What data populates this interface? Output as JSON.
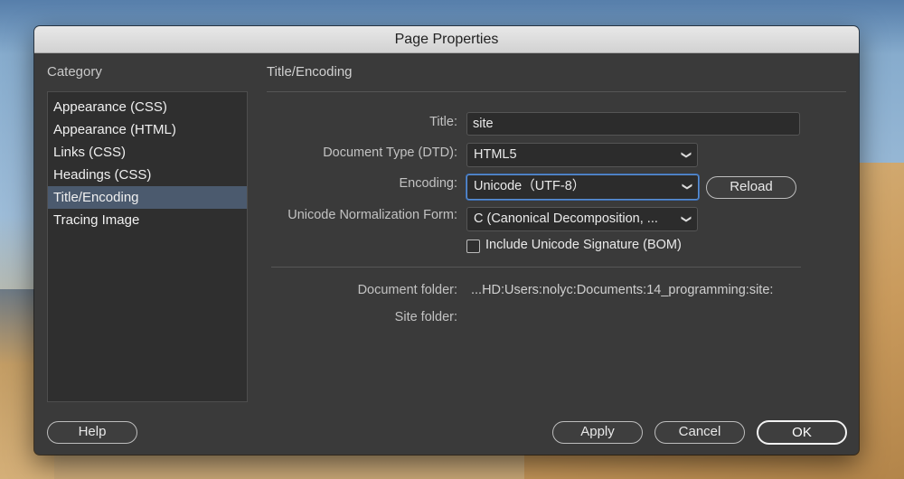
{
  "window": {
    "title": "Page Properties"
  },
  "sidebar": {
    "heading": "Category",
    "items": [
      {
        "label": "Appearance (CSS)"
      },
      {
        "label": "Appearance (HTML)"
      },
      {
        "label": "Links (CSS)"
      },
      {
        "label": "Headings (CSS)"
      },
      {
        "label": "Title/Encoding"
      },
      {
        "label": "Tracing Image"
      }
    ],
    "selected": "Title/Encoding"
  },
  "main": {
    "section_title": "Title/Encoding",
    "title_label": "Title:",
    "title_value": "site",
    "doctype_label": "Document Type (DTD):",
    "doctype_value": "HTML5",
    "encoding_label": "Encoding:",
    "encoding_value": "Unicode（UTF-8）",
    "reload_label": "Reload",
    "normalization_label": "Unicode Normalization Form:",
    "normalization_value": "C (Canonical Decomposition, ...",
    "bom_label": "Include Unicode Signature (BOM)",
    "bom_checked": false,
    "doc_folder_label": "Document folder:",
    "doc_folder_value": "...HD:Users:nolyc:Documents:14_programming:site:",
    "site_folder_label": "Site folder:",
    "site_folder_value": ""
  },
  "footer": {
    "help_label": "Help",
    "apply_label": "Apply",
    "cancel_label": "Cancel",
    "ok_label": "OK"
  },
  "icons": {
    "dropdown": "chevron-down-icon",
    "checkbox": "checkbox-icon"
  },
  "colors": {
    "dialog_bg": "#3a3a3a",
    "selected_bg": "#4b5a6e",
    "focus_ring": "#5b8fd3"
  }
}
